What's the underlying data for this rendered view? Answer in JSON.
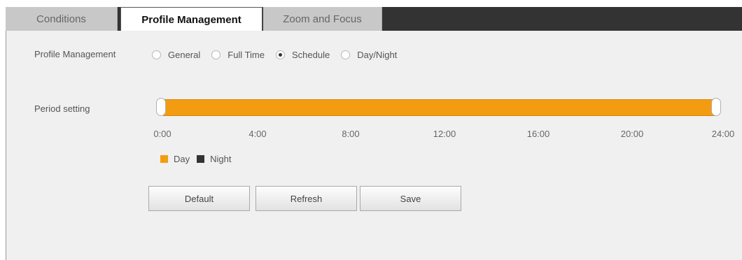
{
  "tabs": [
    {
      "label": "Conditions"
    },
    {
      "label": "Profile Management"
    },
    {
      "label": "Zoom and Focus"
    }
  ],
  "profile": {
    "label": "Profile Management",
    "options": [
      "General",
      "Full Time",
      "Schedule",
      "Day/Night"
    ],
    "selected": "Schedule"
  },
  "period": {
    "label": "Period setting",
    "ticks": [
      "0:00",
      "4:00",
      "8:00",
      "12:00",
      "16:00",
      "20:00",
      "24:00"
    ],
    "start": "0:00",
    "end": "24:00"
  },
  "legend": {
    "day": "Day",
    "night": "Night",
    "day_color": "#f39c12",
    "night_color": "#333333"
  },
  "buttons": {
    "default": "Default",
    "refresh": "Refresh",
    "save": "Save"
  }
}
